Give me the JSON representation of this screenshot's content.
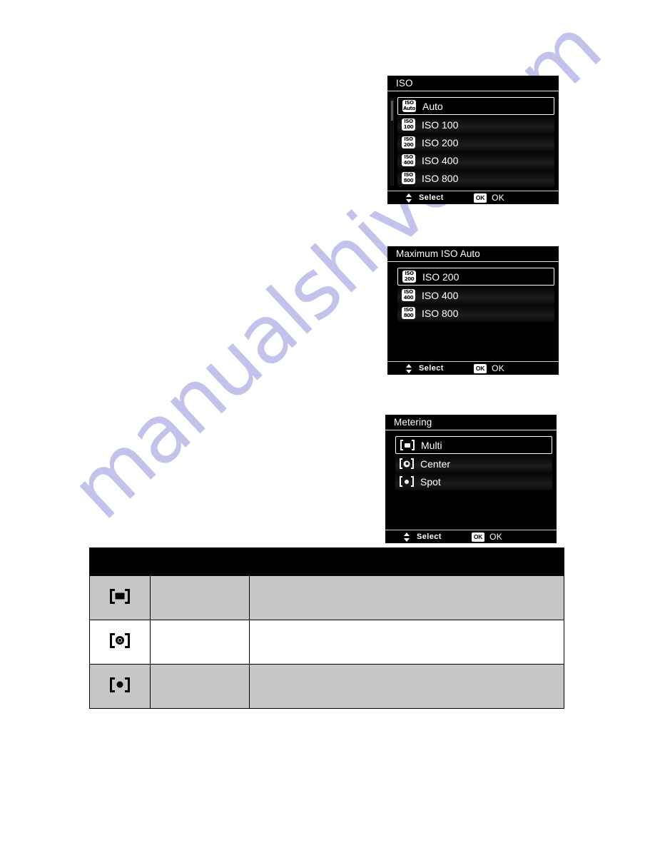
{
  "page": {
    "watermark": "manualshive.com",
    "watermark_color": "#9a9ade",
    "background_color": "#ffffff"
  },
  "screens": [
    {
      "id": "iso",
      "title": "ISO",
      "hint": {
        "select_label": "Select",
        "ok_chip": "OK",
        "ok_label": "OK"
      },
      "items": [
        {
          "icon": "iso-auto-icon",
          "icon_top": "ISO",
          "icon_bottom": "Auto",
          "label": "Auto",
          "selected": true
        },
        {
          "icon": "iso-100-icon",
          "icon_top": "ISO",
          "icon_bottom": "100",
          "label": "ISO 100",
          "selected": false
        },
        {
          "icon": "iso-200-icon",
          "icon_top": "ISO",
          "icon_bottom": "200",
          "label": "ISO 200",
          "selected": false
        },
        {
          "icon": "iso-400-icon",
          "icon_top": "ISO",
          "icon_bottom": "400",
          "label": "ISO 400",
          "selected": false
        },
        {
          "icon": "iso-800-icon",
          "icon_top": "ISO",
          "icon_bottom": "800",
          "label": "ISO 800",
          "selected": false
        }
      ]
    },
    {
      "id": "max-iso-auto",
      "title": "Maximum ISO Auto",
      "hint": {
        "select_label": "Select",
        "ok_chip": "OK",
        "ok_label": "OK"
      },
      "items": [
        {
          "icon": "iso-200-icon",
          "icon_top": "ISO",
          "icon_bottom": "200",
          "label": "ISO 200",
          "selected": true
        },
        {
          "icon": "iso-400-icon",
          "icon_top": "ISO",
          "icon_bottom": "400",
          "label": "ISO 400",
          "selected": false
        },
        {
          "icon": "iso-800-icon",
          "icon_top": "ISO",
          "icon_bottom": "800",
          "label": "ISO 800",
          "selected": false
        }
      ]
    },
    {
      "id": "metering",
      "title": "Metering",
      "hint": {
        "select_label": "Select",
        "ok_chip": "OK",
        "ok_label": "OK"
      },
      "items": [
        {
          "icon": "metering-multi-icon",
          "label": "Multi",
          "selected": true
        },
        {
          "icon": "metering-center-icon",
          "label": "Center",
          "selected": false
        },
        {
          "icon": "metering-spot-icon",
          "label": "Spot",
          "selected": false
        }
      ]
    }
  ],
  "table": {
    "header": {
      "icon": "",
      "mode": "",
      "description": ""
    },
    "rows": [
      {
        "icon": "metering-multi-icon",
        "mode": "",
        "description": ""
      },
      {
        "icon": "metering-center-icon",
        "mode": "",
        "description": ""
      },
      {
        "icon": "metering-spot-icon",
        "mode": "",
        "description": ""
      }
    ]
  }
}
